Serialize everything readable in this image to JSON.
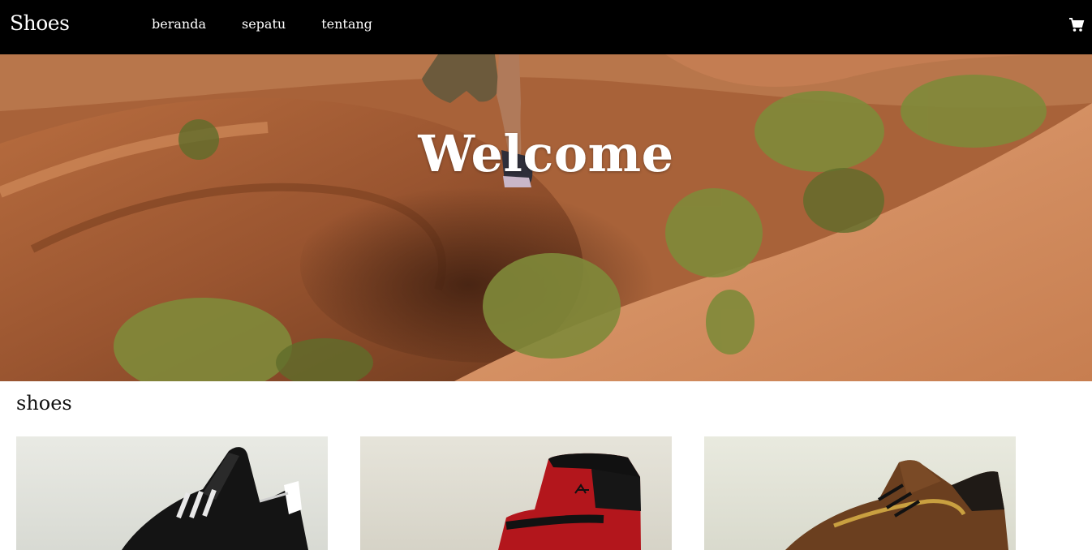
{
  "navbar": {
    "brand": "Shoes",
    "links": [
      {
        "label": "beranda"
      },
      {
        "label": "sepatu"
      },
      {
        "label": "tentang"
      }
    ],
    "cart_icon": "shopping-cart-icon"
  },
  "hero": {
    "title": "Welcome",
    "image": "desert-rock-hiker-photo"
  },
  "section": {
    "title": "shoes"
  },
  "products": [
    {
      "image": "black-adidas-sneaker-photo",
      "color": "#111111"
    },
    {
      "image": "red-black-jordan-high-top-photo",
      "color": "#b3161c"
    },
    {
      "image": "brown-suede-puma-sneaker-photo",
      "color": "#6b3f1f"
    }
  ],
  "colors": {
    "navbar": "#000000",
    "rock": "#c97f4f",
    "shrub": "#8a8a3e"
  }
}
